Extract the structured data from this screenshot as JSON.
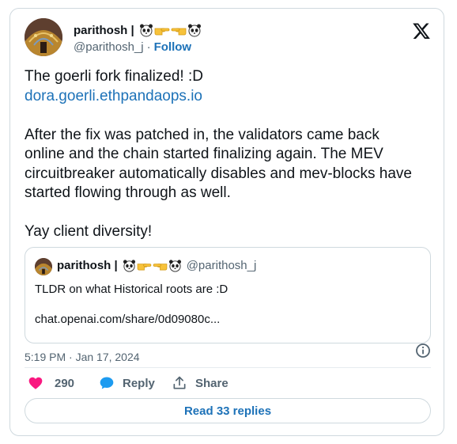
{
  "author": {
    "display_name": "parithosh |",
    "handle": "@parithosh_j",
    "separator": "·",
    "follow_label": "Follow"
  },
  "icons": {
    "x_logo": "x-logo-icon",
    "panda": "panda-face-emoji",
    "point_right": "backhand-index-pointing-right-emoji",
    "point_left": "backhand-index-pointing-left-emoji",
    "info": "info-circle-icon",
    "like": "heart-icon",
    "reply": "speech-bubble-icon",
    "share": "share-upload-icon"
  },
  "tweet": {
    "line1": "The goerli fork finalized! :D",
    "link": "dora.goerli.ethpandaops.io",
    "para2_line1": "After the fix was patched in, the validators came back",
    "para2_line2": "online and the chain started finalizing again. The MEV",
    "para2_line3": "circuitbreaker automatically disables and mev-blocks have",
    "para2_line4": "started flowing through as well.",
    "para3": "Yay client diversity!"
  },
  "quoted": {
    "display_name": "parithosh |",
    "handle": "@parithosh_j",
    "text": "TLDR on what Historical roots are :D",
    "link": "chat.openai.com/share/0d09080c..."
  },
  "timestamp": "5:19 PM · Jan 17, 2024",
  "actions": {
    "like_count": "290",
    "reply_label": "Reply",
    "share_label": "Share"
  },
  "read_replies_label": "Read 33 replies",
  "colors": {
    "link": "#1d72b8",
    "like": "#f91880",
    "reply": "#1d9bf0",
    "muted": "#536471",
    "border": "#cfd9de"
  }
}
